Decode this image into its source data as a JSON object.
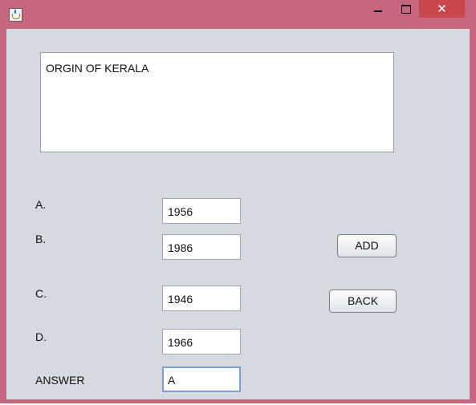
{
  "window": {
    "icon": "java-cup-icon",
    "controls": {
      "minimize": "minimize-icon",
      "maximize": "maximize-icon",
      "close_glyph": "✕"
    }
  },
  "question": {
    "text": "ORGIN OF KERALA"
  },
  "options": [
    {
      "label": "A.",
      "value": "1956"
    },
    {
      "label": "B.",
      "value": "1986"
    },
    {
      "label": "C.",
      "value": "1946"
    },
    {
      "label": "D.",
      "value": "1966"
    }
  ],
  "answer": {
    "label": "ANSWER",
    "value": "A"
  },
  "buttons": {
    "add": "ADD",
    "back": "BACK"
  },
  "colors": {
    "title_bar": "#c7667f",
    "close_button": "#c9474d",
    "panel_background": "#d6d9df",
    "focus_border": "#7b9fd0"
  }
}
